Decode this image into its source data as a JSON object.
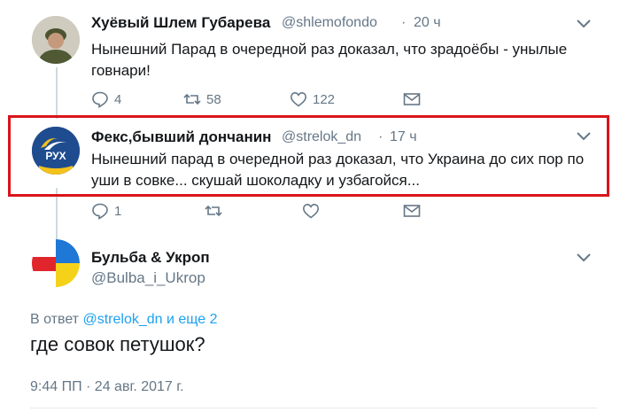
{
  "tweets": [
    {
      "display_name": "Хуёвый Шлем Губарева",
      "handle": "@shlemofondo",
      "time": "20 ч",
      "text": "Нынешний Парад в очередной раз доказал, что зрадоёбы - унылые говнари!",
      "counts": {
        "reply": "4",
        "retweet": "58",
        "like": "122"
      }
    },
    {
      "display_name": "Фекс,бывший дончанин",
      "handle": "@strelok_dn",
      "time": "17 ч",
      "text": "Нынешний парад в очередной раз доказал, что Украина до сих пор по уши в совке... скушай шоколадку и узбагойся...",
      "counts": {
        "reply": "1",
        "retweet": "",
        "like": ""
      },
      "avatar_text": "РУХ"
    }
  ],
  "main_tweet": {
    "display_name": "Бульба & Укроп",
    "handle": "@Bulba_i_Ukrop",
    "reply_prefix": "В ответ",
    "reply_to": "@strelok_dn",
    "reply_suffix": "и еще 2",
    "text": "где совок петушок?",
    "timestamp": "9:44 ПП · 24 авг. 2017 г."
  },
  "colors": {
    "highlight_border": "#d9141a",
    "link": "#1da1f2",
    "muted": "#657786"
  },
  "icons": [
    "reply-icon",
    "retweet-icon",
    "like-icon",
    "message-icon",
    "chevron-down-icon"
  ]
}
